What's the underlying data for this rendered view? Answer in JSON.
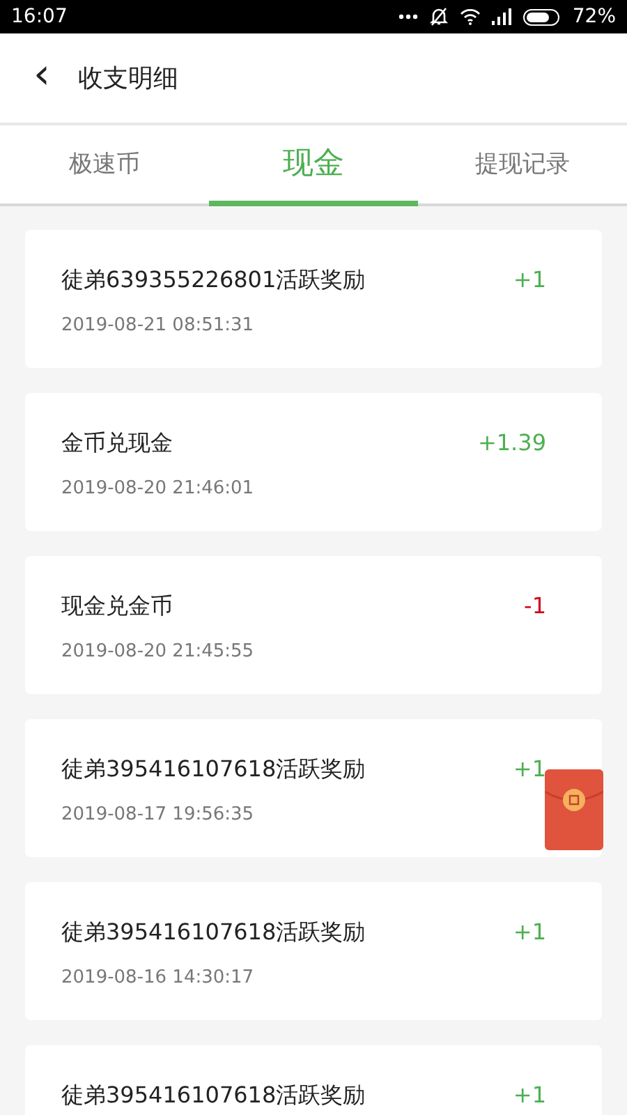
{
  "status_bar": {
    "time": "16:07",
    "battery": "72%"
  },
  "header": {
    "back": "‹",
    "title": "收支明细"
  },
  "tabs": [
    {
      "label": "极速币",
      "selected": false
    },
    {
      "label": "现金",
      "selected": true
    },
    {
      "label": "提现记录",
      "selected": false
    }
  ],
  "records": [
    {
      "title": "徒弟639355226801活跃奖励",
      "time": "2019-08-21 08:51:31",
      "amount": "+1",
      "kind": "income"
    },
    {
      "title": "金币兑现金",
      "time": "2019-08-20 21:46:01",
      "amount": "+1.39",
      "kind": "income"
    },
    {
      "title": "现金兑金币",
      "time": "2019-08-20 21:45:55",
      "amount": "-1",
      "kind": "expense"
    },
    {
      "title": "徒弟395416107618活跃奖励",
      "time": "2019-08-17 19:56:35",
      "amount": "+1",
      "kind": "income"
    },
    {
      "title": "徒弟395416107618活跃奖励",
      "time": "2019-08-16 14:30:17",
      "amount": "+1",
      "kind": "income"
    },
    {
      "title": "徒弟395416107618活跃奖励",
      "amount": "+1",
      "kind": "income"
    }
  ]
}
